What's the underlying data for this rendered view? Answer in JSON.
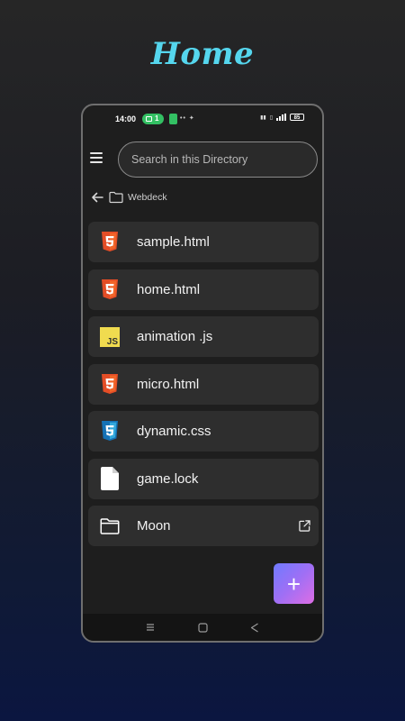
{
  "promo": {
    "title": "Home"
  },
  "status": {
    "time": "14:00",
    "pill_count": "1",
    "battery": "85"
  },
  "search": {
    "placeholder": "Search in this Directory",
    "value": ""
  },
  "breadcrumb": {
    "folder": "Webdeck"
  },
  "files": [
    {
      "name": "sample.html",
      "icon": "html5-icon",
      "color": "#e44d26"
    },
    {
      "name": "home.html",
      "icon": "html5-icon",
      "color": "#e44d26"
    },
    {
      "name": "animation .js",
      "icon": "javascript-icon",
      "color": "#f0db4f"
    },
    {
      "name": "micro.html",
      "icon": "html5-icon",
      "color": "#e44d26"
    },
    {
      "name": "dynamic.css",
      "icon": "css3-icon",
      "color": "#2965f1"
    },
    {
      "name": "game.lock",
      "icon": "file-icon",
      "color": "#ffffff"
    },
    {
      "name": "Moon",
      "icon": "folder-icon",
      "color": "#ffffff"
    }
  ],
  "fab": {
    "label": "+"
  },
  "colors": {
    "accent": "#55d6ee",
    "fab_start": "#6f7bff",
    "fab_end": "#de6ee4",
    "status_green": "#33c063"
  }
}
